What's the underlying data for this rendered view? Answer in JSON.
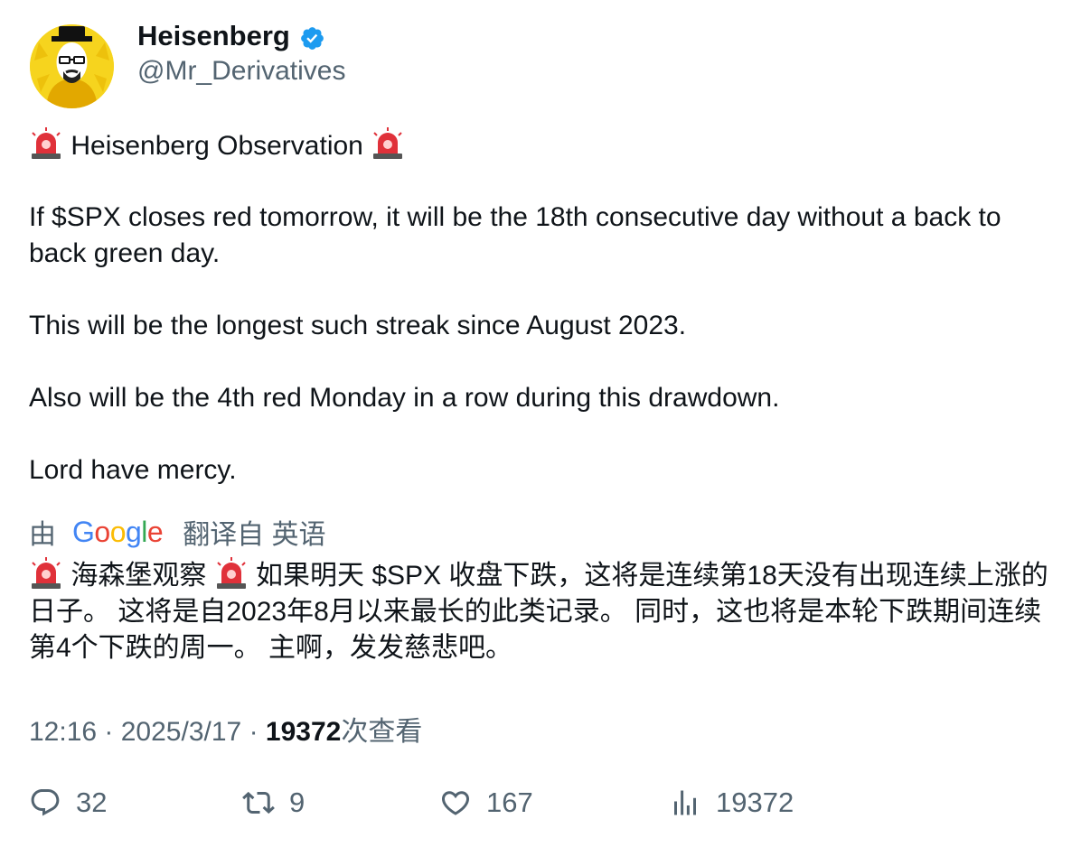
{
  "author": {
    "name": "Heisenberg",
    "handle": "@Mr_Derivatives",
    "verified": true
  },
  "tweet": {
    "title": "Heisenberg Observation",
    "paragraph1": "If $SPX closes red tomorrow, it will be the 18th consecutive day without a back to back green day.",
    "paragraph2": "This will be the longest such streak since August 2023.",
    "paragraph3": "Also will be the 4th red Monday in a row during this drawdown.",
    "paragraph4": "Lord have mercy."
  },
  "translation": {
    "prefix": "由",
    "provider": "Google",
    "suffix": "翻译自 英语",
    "title": "海森堡观察",
    "text": "如果明天 $SPX 收盘下跌，这将是连续第18天没有出现连续上涨的日子。 这将是自2023年8月以来最长的此类记录。 同时，这也将是本轮下跌期间连续第4个下跌的周一。 主啊，发发慈悲吧。"
  },
  "meta": {
    "time": "12:16",
    "date": "2025/3/17",
    "views": "19372",
    "views_label": "次查看"
  },
  "actions": {
    "replies": "32",
    "retweets": "9",
    "likes": "167",
    "views": "19372"
  },
  "colors": {
    "text": "#0f1419",
    "secondary": "#536471",
    "verified": "#1d9bf0",
    "siren": "#e0313a"
  }
}
